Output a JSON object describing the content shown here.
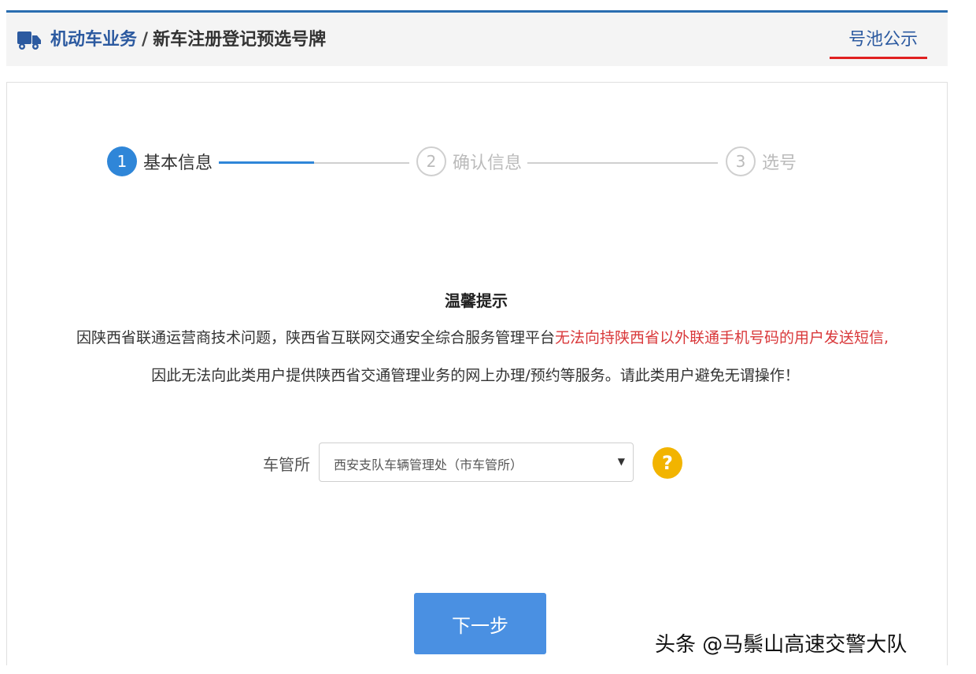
{
  "header": {
    "breadcrumb_primary": "机动车业务",
    "breadcrumb_separator": "/",
    "breadcrumb_secondary": "新车注册登记预选号牌",
    "pool_link": "号池公示",
    "icon": "truck-icon"
  },
  "stepper": {
    "steps": [
      {
        "number": "1",
        "label": "基本信息",
        "state": "active"
      },
      {
        "number": "2",
        "label": "确认信息",
        "state": "inactive"
      },
      {
        "number": "3",
        "label": "选号",
        "state": "inactive"
      }
    ],
    "progress_fraction": 0.5
  },
  "notice": {
    "title": "温馨提示",
    "line1_normal": "因陕西省联通运营商技术问题，陕西省互联网交通安全综合服务管理平台",
    "line1_highlight": "无法向持陕西省以外联通手机号码的用户发送短信,",
    "line2": "因此无法向此类用户提供陕西省交通管理业务的网上办理/预约等服务。请此类用户避免无谓操作！"
  },
  "form": {
    "office_label": "车管所",
    "office_value": "西安支队车辆管理处（市车管所）",
    "help_symbol": "?"
  },
  "next_button": "下一步",
  "watermark": "头条 @马鬃山高速交警大队",
  "colors": {
    "primary": "#2f86d8",
    "highlight_red": "#d9383a",
    "help_yellow": "#f2b400",
    "button_blue": "#4a90e2"
  }
}
